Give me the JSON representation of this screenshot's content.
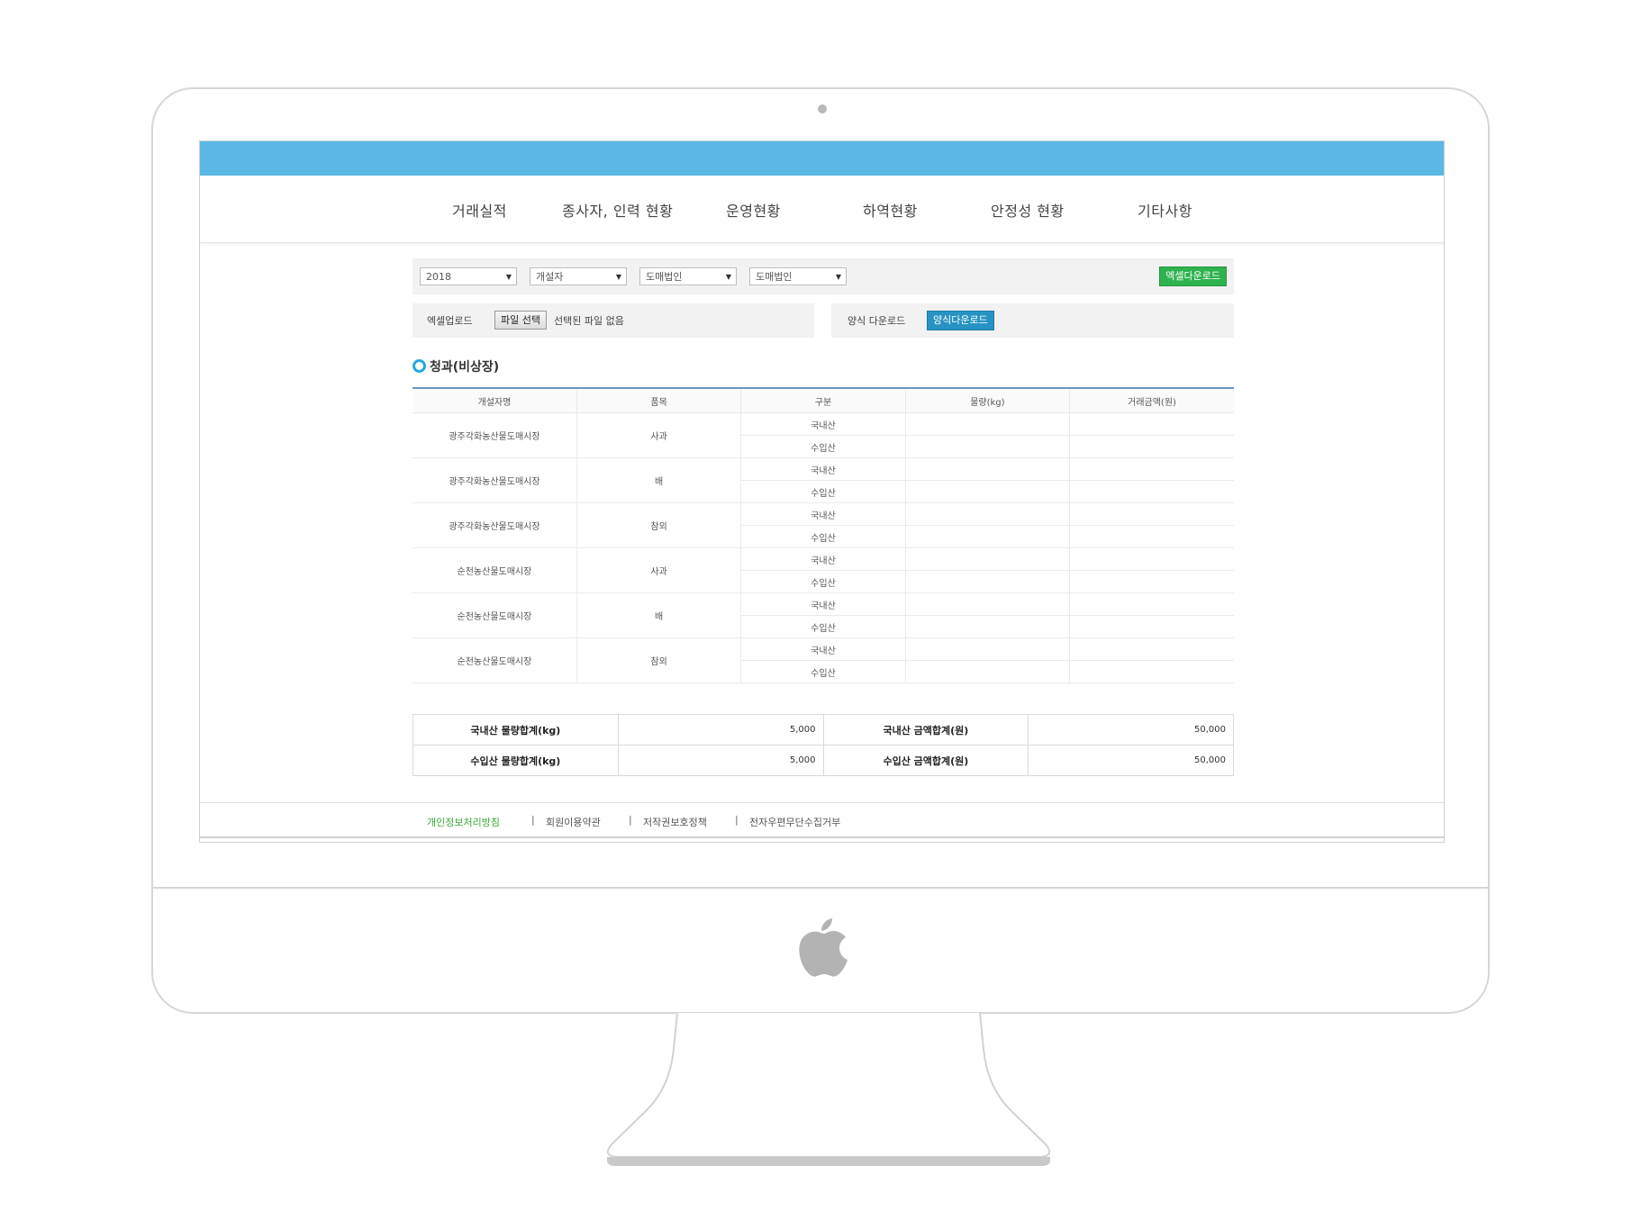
{
  "nav": {
    "items": [
      {
        "label": "거래실적"
      },
      {
        "label": "종사자, 인력 현황"
      },
      {
        "label": "운영현황"
      },
      {
        "label": "하역현황"
      },
      {
        "label": "안정성 현황"
      },
      {
        "label": "기타사항"
      }
    ]
  },
  "filters": {
    "year": "2018",
    "opener": "개설자",
    "corp1": "도매법인",
    "corp2": "도매법인",
    "excel_download": "엑셀다운로드"
  },
  "upload": {
    "label": "엑셀업로드",
    "file_button": "파일 선택",
    "file_status": "선택된 파일 없음"
  },
  "template_download": {
    "label": "양식 다운로드",
    "button": "양식다운로드"
  },
  "section": {
    "title": "청과(비상장)"
  },
  "table": {
    "headers": [
      "개설자명",
      "품목",
      "구분",
      "물량(kg)",
      "거래금액(원)"
    ],
    "groups": [
      {
        "market": "광주각화농산물도매시장",
        "item": "사과",
        "types": [
          "국내산",
          "수입산"
        ]
      },
      {
        "market": "광주각화농산물도매시장",
        "item": "배",
        "types": [
          "국내산",
          "수입산"
        ]
      },
      {
        "market": "광주각화농산물도매시장",
        "item": "참외",
        "types": [
          "국내산",
          "수입산"
        ]
      },
      {
        "market": "순천농산물도매시장",
        "item": "사과",
        "types": [
          "국내산",
          "수입산"
        ]
      },
      {
        "market": "순천농산물도매시장",
        "item": "배",
        "types": [
          "국내산",
          "수입산"
        ]
      },
      {
        "market": "순천농산물도매시장",
        "item": "참외",
        "types": [
          "국내산",
          "수입산"
        ]
      }
    ]
  },
  "totals": {
    "domestic_qty_label": "국내산 물량합계(kg)",
    "domestic_qty": "5,000",
    "domestic_amt_label": "국내산 금액합계(원)",
    "domestic_amt": "50,000",
    "import_qty_label": "수입산 물량합계(kg)",
    "import_qty": "5,000",
    "import_amt_label": "수입산 금액합계(원)",
    "import_amt": "50,000"
  },
  "footer": {
    "links": [
      {
        "label": "개인정보처리방침"
      },
      {
        "label": "회원이용약관"
      },
      {
        "label": "저작권보호정책"
      },
      {
        "label": "전자우편무단수집거부"
      }
    ],
    "separator": "|"
  },
  "colors": {
    "topbar": "#5bb7e3",
    "excel_button": "#2eb34e",
    "template_button": "#2793c4",
    "footer_highlight": "#3caa3c",
    "table_header_rule": "#6a95c4"
  },
  "icons": [
    "apple-logo-icon",
    "camera-icon",
    "bullet-circle-icon",
    "caret-down-icon"
  ]
}
